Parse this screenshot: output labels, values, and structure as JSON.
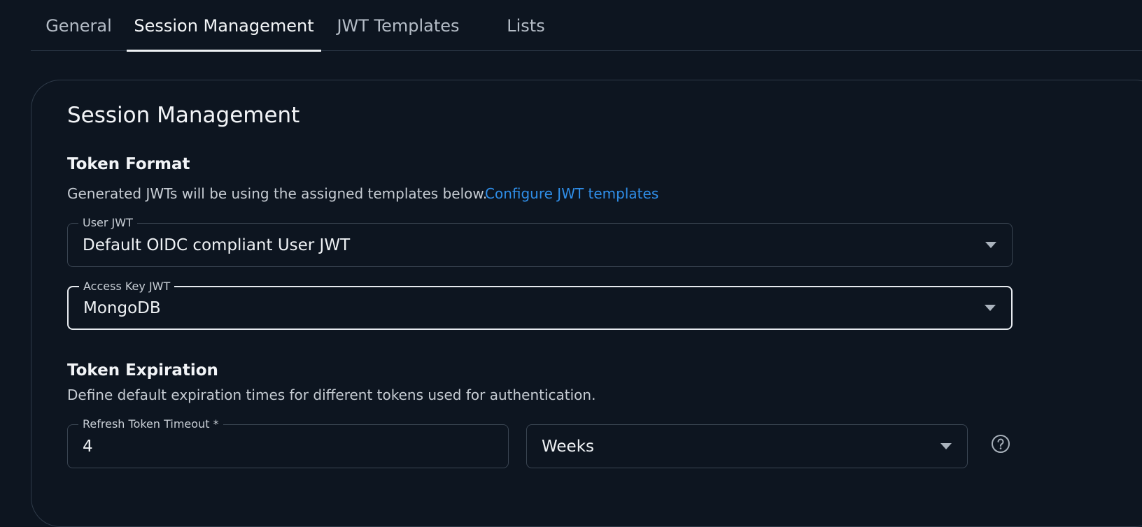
{
  "tabs": [
    {
      "label": "General",
      "active": false
    },
    {
      "label": "Session Management",
      "active": true
    },
    {
      "label": "JWT Templates",
      "active": false
    },
    {
      "label": "Lists",
      "active": false
    }
  ],
  "card": {
    "title": "Session Management",
    "token_format": {
      "heading": "Token Format",
      "description": "Generated JWTs will be using the assigned templates below.",
      "link": "Configure JWT templates",
      "user_jwt": {
        "label": "User JWT",
        "value": "Default OIDC compliant User JWT"
      },
      "access_key_jwt": {
        "label": "Access Key JWT",
        "value": "MongoDB"
      }
    },
    "token_expiration": {
      "heading": "Token Expiration",
      "description": "Define default expiration times for different tokens used for authentication.",
      "refresh_timeout": {
        "label": "Refresh Token Timeout *",
        "value": "4"
      },
      "refresh_unit": {
        "value": "Weeks"
      }
    }
  },
  "icons": {
    "dropdown": "chevron-down-icon",
    "help": "help-circle-icon"
  },
  "colors": {
    "background": "#0d1520",
    "link": "#2f8ee8",
    "border": "#3a4552",
    "focus_border": "#e6eaef"
  }
}
